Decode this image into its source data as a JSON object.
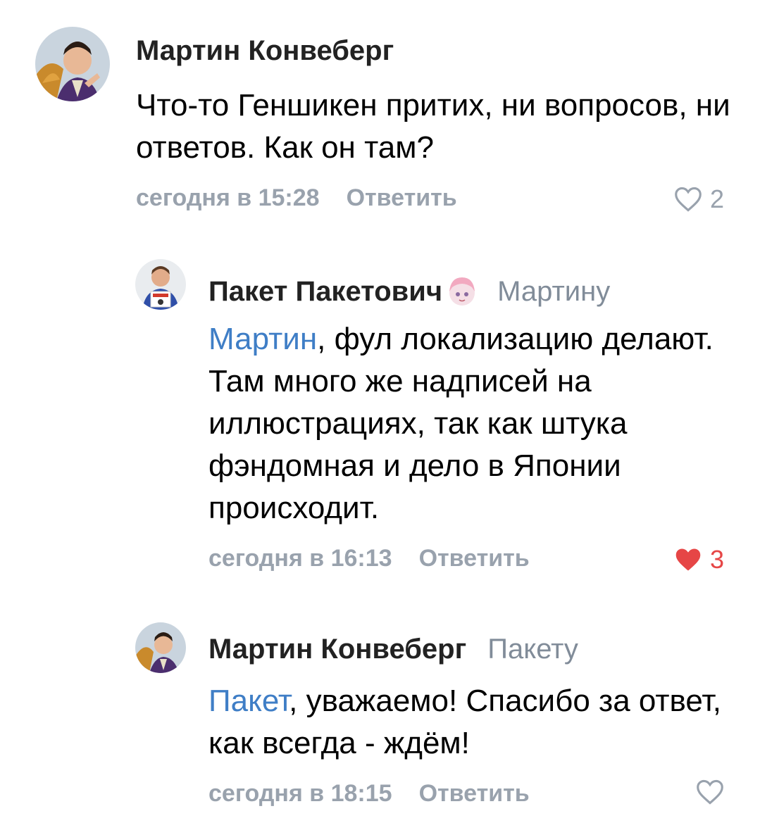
{
  "comments": [
    {
      "author": "Мартин Конвеберг",
      "reply_to": "",
      "mention": "",
      "text": "Что-то Геншикен притих, ни вопросов, ни ответов. Как он там?",
      "time": "сегодня в 15:28",
      "reply_label": "Ответить",
      "likes": "2",
      "liked": false
    },
    {
      "author": "Пакет Пакетович",
      "reply_to": "Мартину",
      "mention": "Мартин",
      "text": ", фул локализацию делают. Там много же надписей на иллюстрациях, так как штука фэндомная и дело в Японии происходит.",
      "time": "сегодня в 16:13",
      "reply_label": "Ответить",
      "likes": "3",
      "liked": true
    },
    {
      "author": "Мартин Конвеберг",
      "reply_to": "Пакету",
      "mention": "Пакет",
      "text": ", уважаемо! Спасибо за ответ, как всегда - ждём!",
      "time": "сегодня в 18:15",
      "reply_label": "Ответить",
      "likes": "",
      "liked": false
    }
  ],
  "colors": {
    "mention": "#3f7ec6",
    "meta": "#99a2ad",
    "reply_to": "#818c99",
    "like_active": "#e64646"
  },
  "icons": {
    "like": "heart-outline-icon",
    "like_active": "heart-filled-icon",
    "badge": "anime-girl-badge-icon"
  }
}
